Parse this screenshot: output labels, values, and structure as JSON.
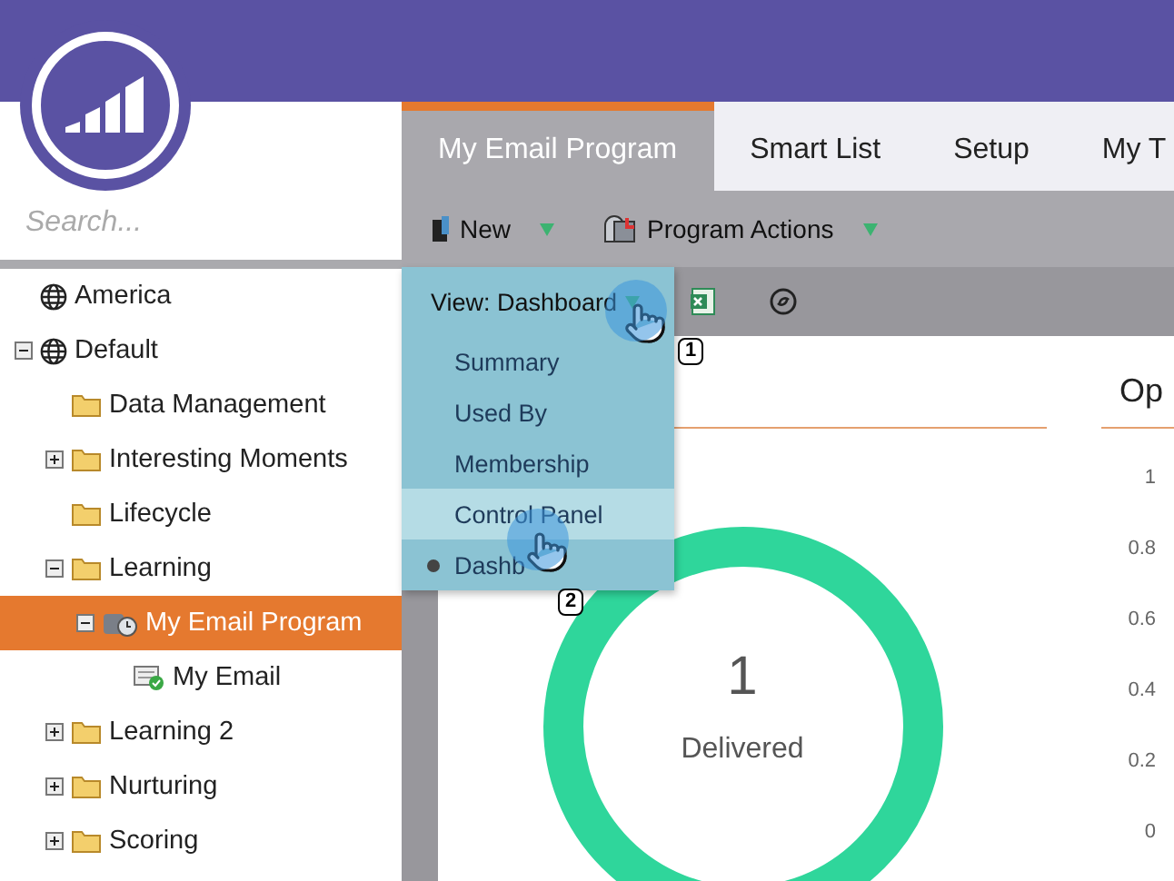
{
  "sidebar": {
    "search": {
      "placeholder": "Search..."
    },
    "tree": [
      {
        "label": "America",
        "kind": "globe",
        "selected": false
      },
      {
        "label": "Default",
        "kind": "globe",
        "expanded": true,
        "selected": false,
        "children": [
          {
            "label": "Data Management",
            "kind": "folder",
            "selected": false
          },
          {
            "label": "Interesting Moments",
            "kind": "folder",
            "expanded": false,
            "selected": false
          },
          {
            "label": "Lifecycle",
            "kind": "folder",
            "selected": false
          },
          {
            "label": "Learning",
            "kind": "folder",
            "expanded": true,
            "selected": false,
            "children": [
              {
                "label": "My Email Program",
                "kind": "program",
                "expanded": true,
                "selected": true,
                "children": [
                  {
                    "label": "My Email",
                    "kind": "email",
                    "selected": false
                  }
                ]
              }
            ]
          },
          {
            "label": "Learning 2",
            "kind": "folder",
            "expanded": false,
            "selected": false
          },
          {
            "label": "Nurturing",
            "kind": "folder",
            "expanded": false,
            "selected": false
          },
          {
            "label": "Scoring",
            "kind": "folder",
            "expanded": false,
            "selected": false
          }
        ]
      }
    ]
  },
  "tabs": [
    {
      "label": "My Email Program",
      "selected": true
    },
    {
      "label": "Smart List",
      "selected": false
    },
    {
      "label": "Setup",
      "selected": false
    },
    {
      "label": "My T",
      "selected": false
    }
  ],
  "toolbar": [
    {
      "label": "New",
      "kind": "book"
    },
    {
      "label": "Program Actions",
      "kind": "mailbox"
    }
  ],
  "view_menu": {
    "label": "View: Dashboard",
    "items": [
      {
        "label": "Summary",
        "selected": false,
        "highlighted": false
      },
      {
        "label": "Used By",
        "selected": false,
        "highlighted": false
      },
      {
        "label": "Membership",
        "selected": false,
        "highlighted": false
      },
      {
        "label": "Control Panel",
        "selected": false,
        "highlighted": true
      },
      {
        "label": "Dashb",
        "selected": true,
        "highlighted": false
      }
    ]
  },
  "callouts": [
    "1",
    "2"
  ],
  "donut": {
    "value": "1",
    "label": "Delivered"
  },
  "side_panel": {
    "title": "Op",
    "axis_labels": [
      "1",
      "0.8",
      "0.6",
      "0.4",
      "0.2",
      "0"
    ]
  }
}
